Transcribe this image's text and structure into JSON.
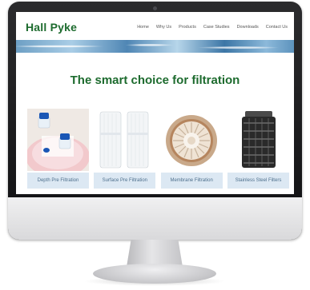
{
  "site": {
    "logo": "Hall Pyke",
    "nav": [
      "Home",
      "Why Us",
      "Products",
      "Case Studies",
      "Downloads",
      "Contact Us"
    ],
    "headline": "The smart choice for filtration",
    "products": [
      {
        "label": "Depth Pre Filtration"
      },
      {
        "label": "Surface Pre Filtration"
      },
      {
        "label": "Membrane Filtration"
      },
      {
        "label": "Stainless Steel Filters"
      }
    ]
  },
  "colors": {
    "brand_green": "#1d6b2e",
    "caption_bg": "#dce8f3",
    "caption_text": "#4d6f8c",
    "bezel": "#1a1a1c"
  }
}
